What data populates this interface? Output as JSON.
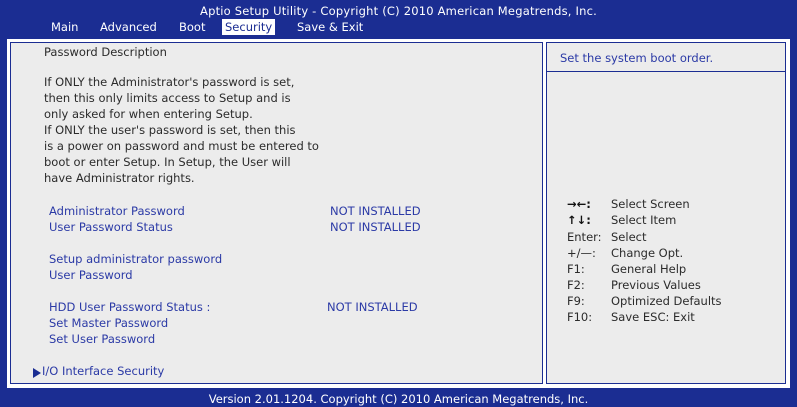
{
  "header": {
    "title": "Aptio Setup Utility - Copyright (C) 2010 American Megatrends, Inc.",
    "tabs": [
      {
        "label": "Main"
      },
      {
        "label": "Advanced"
      },
      {
        "label": "Boot"
      },
      {
        "label": "Security",
        "active": true
      },
      {
        "label": "Save & Exit"
      }
    ]
  },
  "left_pane": {
    "description_title": "Password Description",
    "description_lines": [
      "If ONLY the Administrator's password is set,",
      "then this only limits access to Setup and is",
      "only asked for when entering Setup.",
      "If ONLY the user's password is set, then this",
      "is a power on password and must be entered to",
      "boot or enter Setup. In Setup, the User will",
      "have Administrator rights."
    ],
    "status_rows": [
      {
        "label": "Administrator Password",
        "value": "NOT INSTALLED"
      },
      {
        "label": "User Password Status",
        "value": "NOT INSTALLED"
      }
    ],
    "setup_items": [
      {
        "label": "Setup administrator password"
      },
      {
        "label": "User Password"
      }
    ],
    "hdd_status": {
      "label": "HDD User Password Status  :",
      "value": "NOT INSTALLED"
    },
    "hdd_items": [
      {
        "label": "Set Master Password"
      },
      {
        "label": "Set User Password"
      }
    ],
    "submenu": {
      "label": "I/O Interface Security",
      "icon": "triangle-right-icon"
    }
  },
  "right_pane": {
    "help_text": "Set the system boot order.",
    "key_legend": [
      {
        "key": "→←:",
        "action": "Select Screen"
      },
      {
        "key": "↑↓:",
        "action": "Select Item"
      },
      {
        "key": "Enter:",
        "action": "Select"
      },
      {
        "key": "+/—:",
        "action": "Change Opt."
      },
      {
        "key": "F1:",
        "action": "General Help"
      },
      {
        "key": "F2:",
        "action": "Previous Values"
      },
      {
        "key": "F9:",
        "action": "Optimized Defaults"
      },
      {
        "key": "F10:",
        "action": "Save   ESC: Exit"
      }
    ]
  },
  "footer": {
    "text": "Version 2.01.1204. Copyright (C) 2010 American Megatrends, Inc."
  },
  "colors": {
    "frame_blue": "#1b2d92",
    "pane_gray": "#ececec",
    "item_blue": "#2b3aa6",
    "desc_dark": "#2b2b2b"
  }
}
